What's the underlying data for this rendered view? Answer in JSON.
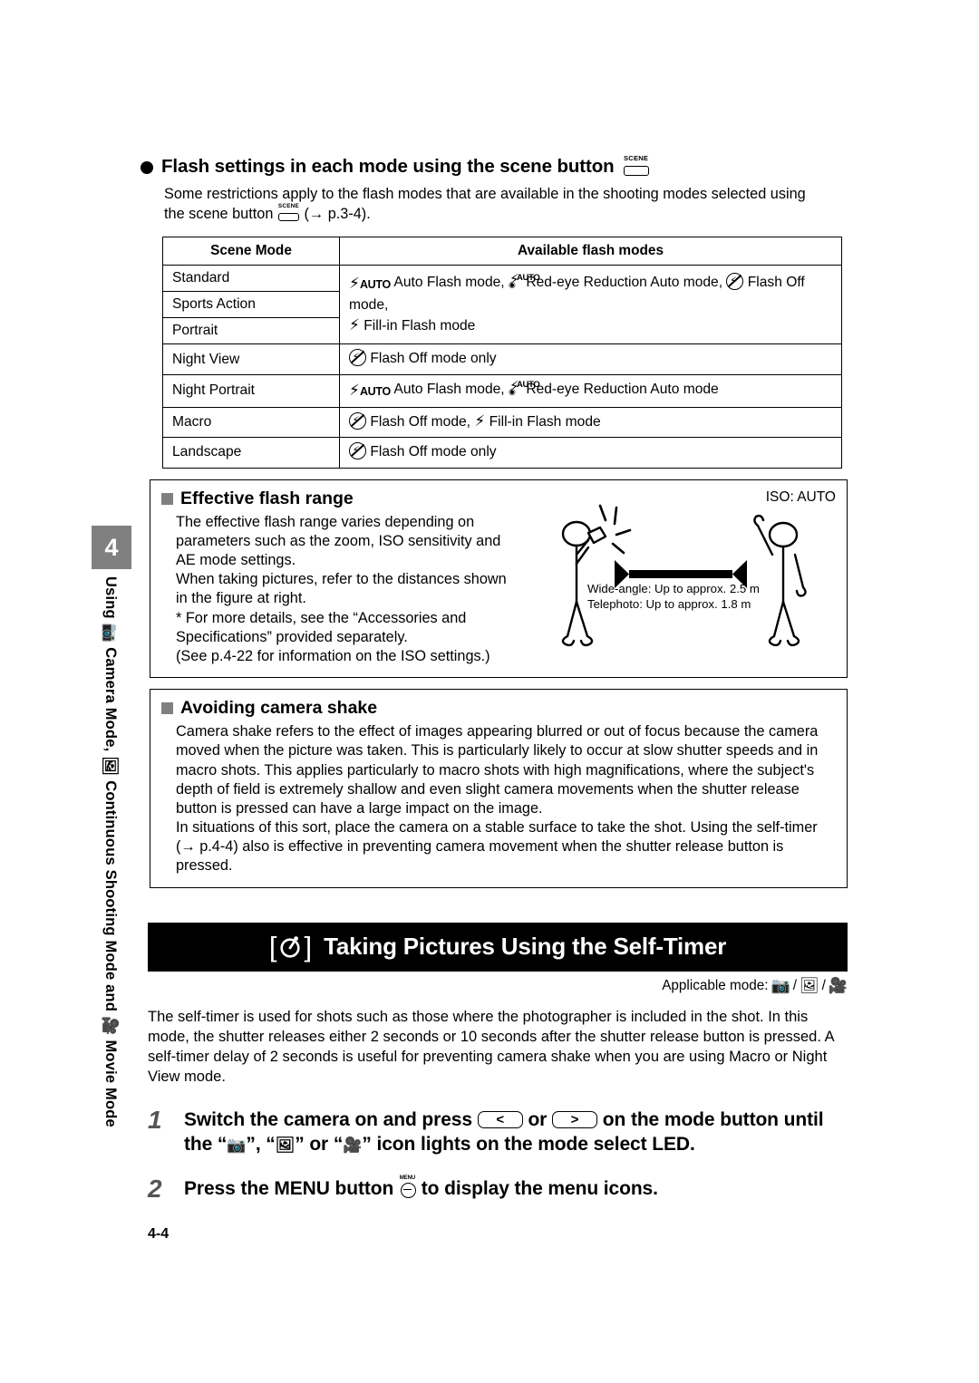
{
  "chapter": {
    "number": "4",
    "rail_parts": [
      "Using",
      "camera-icon",
      "Camera Mode,",
      "continuous-icon",
      "Continuous Shooting Mode and",
      "movie-icon",
      "Movie Mode"
    ],
    "rail_text": "Using  Camera Mode,  Continuous Shooting Mode and  Movie Mode"
  },
  "flash_section": {
    "heading": "Flash settings in each mode using the scene button",
    "heading_icon": "scene-button-icon",
    "intro_line1": "Some restrictions apply to the flash modes that are available in the shooting modes selected using",
    "intro_line2_pre": "the scene button",
    "intro_line2_post": "(→ p.3-4).",
    "scene_label": "SCENE"
  },
  "table": {
    "headers": [
      "Scene Mode",
      "Available flash modes"
    ],
    "group1": {
      "modes": [
        "Standard",
        "Sports Action",
        "Portrait"
      ],
      "flash_line1_a": "Auto Flash mode,",
      "flash_line1_b": "Red-eye Reduction Auto mode,",
      "flash_line1_c": "Flash Off mode,",
      "flash_line2": "Fill-in Flash mode",
      "auto_tag": "AUTO"
    },
    "rows": [
      {
        "mode": "Night View",
        "text_a": "Flash Off mode only",
        "kind": "off-only"
      },
      {
        "mode": "Night Portrait",
        "text_a": "Auto Flash mode,",
        "text_b": "Red-eye Reduction Auto mode",
        "kind": "auto-redeye"
      },
      {
        "mode": "Macro",
        "text_a": "Flash Off mode,",
        "text_b": "Fill-in Flash  mode",
        "kind": "off-fillin"
      },
      {
        "mode": "Landscape",
        "text_a": "Flash Off mode only",
        "kind": "off-only"
      }
    ]
  },
  "effective_range": {
    "title": "Effective flash range",
    "lines": [
      "The effective flash range varies depending on",
      "parameters such as the zoom, ISO sensitivity and",
      "AE mode settings.",
      "When taking pictures, refer to the distances shown",
      "in the figure at right.",
      "* For more details, see the “Accessories and",
      "Specifications” provided separately.",
      "(See p.4-22 for information on the ISO settings.)"
    ],
    "iso_label": "ISO: AUTO",
    "wide_angle": "Wide-angle: Up to approx. 2.5 m",
    "telephoto": "Telephoto: Up to approx. 1.8 m"
  },
  "camera_shake": {
    "title": "Avoiding camera shake",
    "paragraph1": "Camera shake refers to the effect of images appearing blurred or out of focus because the camera moved when the picture was taken. This is particularly likely to occur at slow shutter speeds and in macro shots. This applies particularly to macro shots with high magnifications, where the subject's depth of field is extremely shallow and even slight camera movements when the shutter release button is pressed can have a large impact on the image.",
    "paragraph2": "In situations of this sort, place the camera on a stable surface to take the shot. Using the self-timer (→ p.4-4) also is effective in preventing camera movement when the shutter release button is pressed."
  },
  "self_timer": {
    "banner_title": "Taking Pictures Using the Self-Timer",
    "banner_icon": "self-timer-icon",
    "applicable_label": "Applicable mode:",
    "applicable_modes": [
      "camera-icon",
      "continuous-shooting-icon",
      "movie-icon"
    ],
    "lead": "The self-timer is used for shots such as those where the photographer is included in the shot. In this mode, the shutter releases either 2 seconds or 10 seconds after the shutter release button is pressed. A self-timer delay of 2 seconds is useful for preventing camera shake when you are using Macro or Night View mode.",
    "steps": [
      {
        "num": "1",
        "p1": "Switch the camera on and press",
        "key_left": "<",
        "mid1": "or",
        "key_right": ">",
        "p2": "on the mode button until the “",
        "p3": "”, “",
        "p4": "” or “",
        "p5": "” icon lights on the mode select LED."
      },
      {
        "num": "2",
        "p1": "Press the MENU button",
        "p2": "to display the menu icons.",
        "menu_label": "MENU"
      }
    ]
  },
  "footer": {
    "page_number": "4-4"
  },
  "colors": {
    "banner_bg": "#000000",
    "chapter_badge": "#808080",
    "square_marker": "#808080"
  }
}
